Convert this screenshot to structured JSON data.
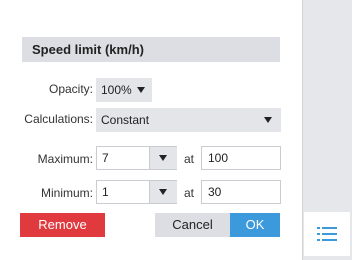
{
  "panel": {
    "title": "Speed limit (km/h)"
  },
  "opacity": {
    "label": "Opacity:",
    "value": "100%"
  },
  "calculations": {
    "label": "Calculations:",
    "value": "Constant"
  },
  "maximum": {
    "label": "Maximum:",
    "value": "7",
    "at_label": "at",
    "at_value": "100"
  },
  "minimum": {
    "label": "Minimum:",
    "value": "1",
    "at_label": "at",
    "at_value": "30"
  },
  "actions": {
    "remove_label": "Remove",
    "cancel_label": "Cancel",
    "ok_label": "OK"
  },
  "sidebar": {
    "icon": "list-icon"
  },
  "colors": {
    "remove": "#e0393e",
    "ok": "#3b99dc",
    "header_bg": "#dcdee3",
    "sidebar_bg": "#e6e7eb",
    "icon": "#3b99dc"
  }
}
